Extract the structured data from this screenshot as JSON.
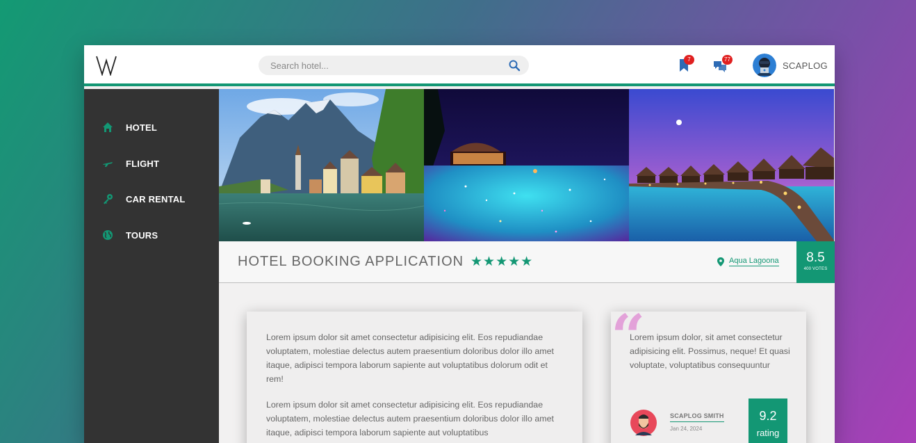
{
  "header": {
    "logo_icon": "w-logo-icon",
    "search": {
      "placeholder": "Search hotel..."
    },
    "bookmarks": {
      "icon": "bookmark-icon",
      "badge": "7"
    },
    "messages": {
      "icon": "chat-icon",
      "badge": "77"
    },
    "user": {
      "name": "SCAPLOG",
      "avatar_icon": "hacker-avatar-icon"
    }
  },
  "sidebar": {
    "items": [
      {
        "label": "HOTEL",
        "icon": "home-icon"
      },
      {
        "label": "FLIGHT",
        "icon": "plane-icon"
      },
      {
        "label": "CAR RENTAL",
        "icon": "key-icon"
      },
      {
        "label": "TOURS",
        "icon": "globe-icon"
      }
    ]
  },
  "gallery": {
    "photos": [
      "lakeside-village-photo",
      "infinity-pool-night-photo",
      "overwater-bungalows-photo"
    ]
  },
  "listing": {
    "title": "HOTEL BOOKING APPLICATION",
    "stars": "★★★★★",
    "location": "Aqua Lagoona",
    "score": "8.5",
    "votes": "400 VOTES"
  },
  "description": {
    "paragraphs": [
      "Lorem ipsum dolor sit amet consectetur adipisicing elit. Eos repudiandae voluptatem, molestiae delectus autem praesentium doloribus dolor illo amet itaque, adipisci tempora laborum sapiente aut voluptatibus dolorum odit et rem!",
      "Lorem ipsum dolor sit amet consectetur adipisicing elit. Eos repudiandae voluptatem, molestiae delectus autem praesentium doloribus dolor illo amet itaque, adipisci tempora laborum sapiente aut voluptatibus"
    ]
  },
  "review": {
    "quote_mark": "“",
    "text": "Lorem ipsum dolor, sit amet consectetur adipisicing elit. Possimus, neque! Et quasi voluptate, voluptatibus consequuntur",
    "author": "SCAPLOG SMITH",
    "date": "Jan 24, 2024",
    "score": "9.2",
    "score_label": "rating"
  },
  "colors": {
    "accent": "#139774",
    "sidebar_bg": "#333333",
    "badge": "#e02020",
    "quote": "#e3a2d9"
  }
}
